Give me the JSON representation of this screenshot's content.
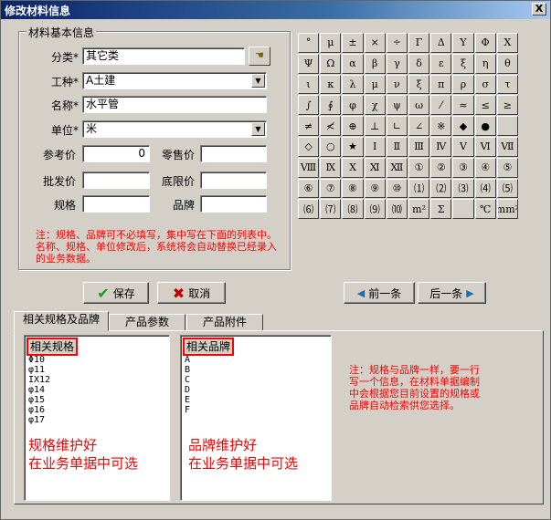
{
  "window": {
    "title": "修改材料信息",
    "close_label": "X"
  },
  "basic_info": {
    "group_label": "材料基本信息",
    "category": {
      "label": "分类*",
      "value": "其它类"
    },
    "work_type": {
      "label": "工种*",
      "value": "A土建"
    },
    "name": {
      "label": "名称*",
      "value": "水平管"
    },
    "unit": {
      "label": "单位*",
      "value": "米"
    },
    "reference_price": {
      "label": "参考价",
      "value": "0"
    },
    "retail_price": {
      "label": "零售价",
      "value": ""
    },
    "wholesale_price": {
      "label": "批发价",
      "value": ""
    },
    "floor_price": {
      "label": "底限价",
      "value": ""
    },
    "spec": {
      "label": "规格",
      "value": ""
    },
    "brand": {
      "label": "品牌",
      "value": ""
    },
    "note": "注：规格、品牌可不必填写，集中写在下面的列表中。名称、规格、单位修改后，系统将会自动替换已经录入的业务数据。"
  },
  "symbols": [
    "°",
    "μ",
    "±",
    "×",
    "÷",
    "Γ",
    "Δ",
    "Υ",
    "Φ",
    "Χ",
    "Ψ",
    "Ω",
    "α",
    "β",
    "γ",
    "δ",
    "ε",
    "ξ",
    "η",
    "θ",
    "ι",
    "κ",
    "λ",
    "μ",
    "ν",
    "ξ",
    "π",
    "ρ",
    "σ",
    "τ",
    "∫",
    "∮",
    "φ",
    "χ",
    "ψ",
    "ω",
    "⁄",
    "≈",
    "≤",
    "≥",
    "≠",
    "≮",
    "⊕",
    "⊥",
    "∟",
    "∠",
    "※",
    "◆",
    "●",
    "",
    "◇",
    "○",
    "★",
    "Ⅰ",
    "Ⅱ",
    "Ⅲ",
    "Ⅳ",
    "Ⅴ",
    "Ⅵ",
    "Ⅶ",
    "Ⅷ",
    "Ⅸ",
    "Ⅹ",
    "Ⅺ",
    "Ⅻ",
    "①",
    "②",
    "③",
    "④",
    "⑤",
    "⑥",
    "⑦",
    "⑧",
    "⑨",
    "⑩",
    "⑴",
    "⑵",
    "⑶",
    "⑷",
    "⑸",
    "⑹",
    "⑺",
    "⑻",
    "⑼",
    "⑽",
    "m²",
    "Σ",
    "",
    "℃",
    "mm²"
  ],
  "buttons": {
    "save": "保存",
    "cancel": "取消",
    "prev": "前一条",
    "next": "后一条"
  },
  "tabs": [
    "相关规格及品牌",
    "产品参数",
    "产品附件"
  ],
  "spec_list": {
    "header": "相关规格",
    "items": [
      "Φ10",
      "φ11",
      "IX12",
      "φ14",
      "φ15",
      "φ16",
      "φ17"
    ],
    "overlay_line1": "规格维护好",
    "overlay_line2": "在业务单据中可选"
  },
  "brand_list": {
    "header": "相关品牌",
    "items": [
      "A",
      "B",
      "C",
      "D",
      "E",
      "F"
    ],
    "overlay_line1": "品牌维护好",
    "overlay_line2": "在业务单据中可选"
  },
  "tab_note": "注：规格与品牌一样，要一行写一个信息，在材料单据编制中会根据您目前设置的规格或品牌自动检索供您选择。"
}
